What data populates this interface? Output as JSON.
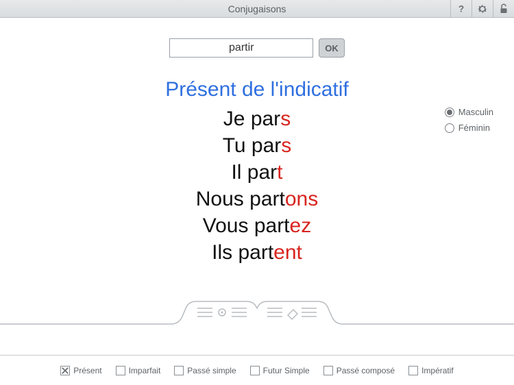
{
  "header": {
    "title": "Conjugaisons"
  },
  "search": {
    "value": "partir",
    "ok_label": "OK"
  },
  "tense_title": "Présent de l'indicatif",
  "conjugation": [
    {
      "stem": "Je par",
      "ending": "s"
    },
    {
      "stem": "Tu par",
      "ending": "s"
    },
    {
      "stem": "Il par",
      "ending": "t"
    },
    {
      "stem": "Nous part",
      "ending": "ons"
    },
    {
      "stem": "Vous part",
      "ending": "ez"
    },
    {
      "stem": "Ils part",
      "ending": "ent"
    }
  ],
  "gender": {
    "options": [
      {
        "label": "Masculin",
        "checked": true
      },
      {
        "label": "Féminin",
        "checked": false
      }
    ]
  },
  "footer": {
    "options": [
      {
        "label": "Présent",
        "checked": true
      },
      {
        "label": "Imparfait",
        "checked": false
      },
      {
        "label": "Passé simple",
        "checked": false
      },
      {
        "label": "Futur Simple",
        "checked": false
      },
      {
        "label": "Passé composé",
        "checked": false
      },
      {
        "label": "Impératif",
        "checked": false
      }
    ]
  }
}
